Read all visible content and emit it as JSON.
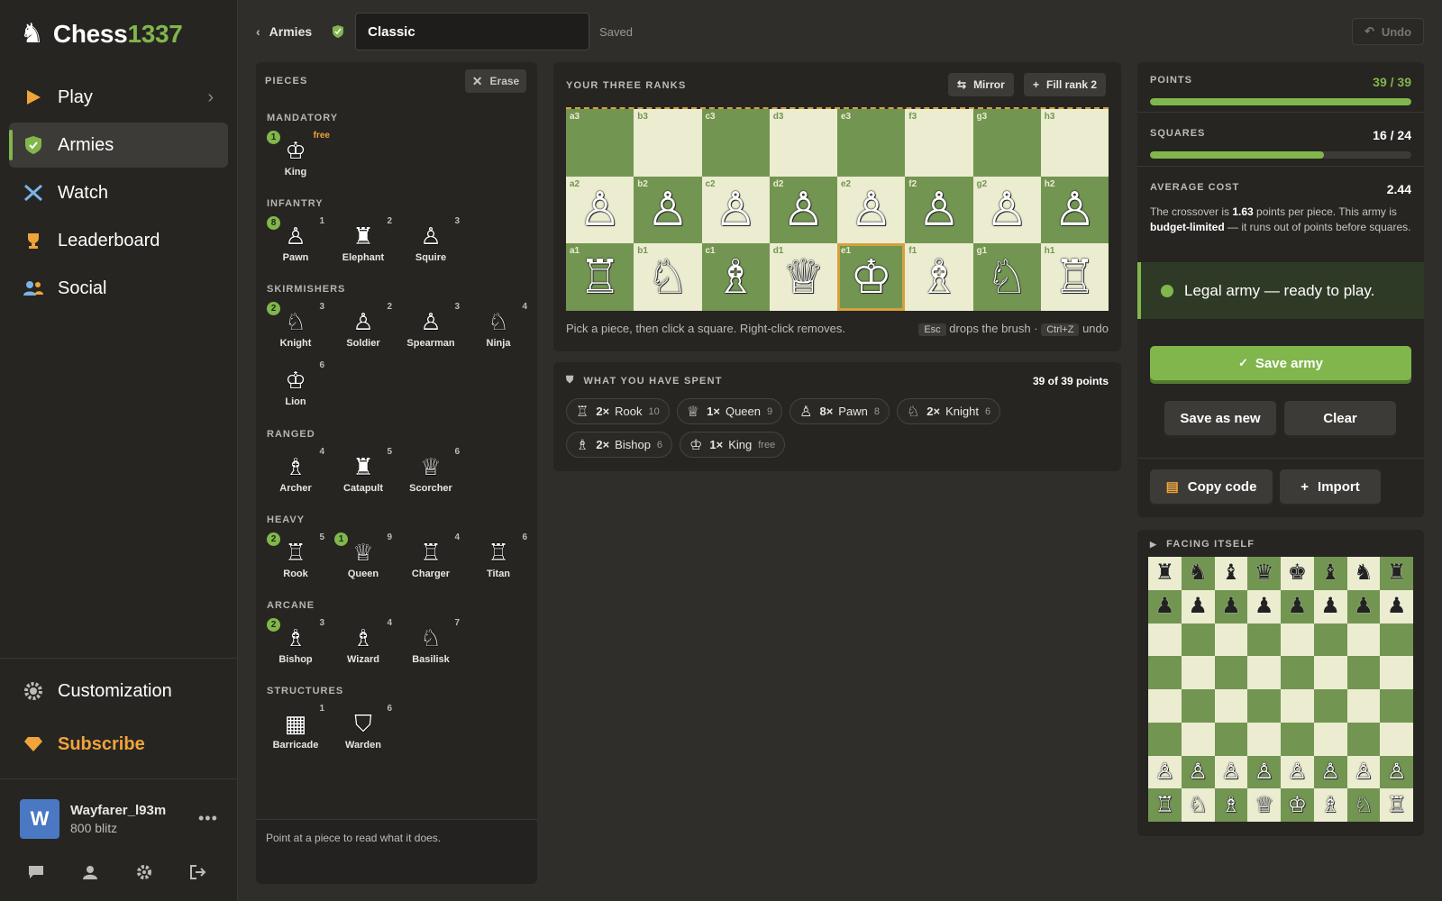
{
  "brand": {
    "name_a": "Chess",
    "name_b": "1337"
  },
  "nav": {
    "play": "Play",
    "armies": "Armies",
    "watch": "Watch",
    "leaderboard": "Leaderboard",
    "social": "Social",
    "customization": "Customization",
    "subscribe": "Subscribe"
  },
  "user": {
    "initial": "W",
    "name": "Wayfarer_l93m",
    "rating": "800 blitz"
  },
  "topbar": {
    "breadcrumb": "Armies",
    "army_name": "Classic",
    "status": "Saved",
    "undo": "Undo"
  },
  "pieces_panel": {
    "title": "PIECES",
    "erase": "Erase",
    "hint": "Point at a piece to read what it does.",
    "categories": {
      "mandatory": "MANDATORY",
      "infantry": "INFANTRY",
      "skirmishers": "SKIRMISHERS",
      "ranged": "RANGED",
      "heavy": "HEAVY",
      "arcane": "ARCANE",
      "structures": "STRUCTURES"
    },
    "pieces": {
      "king": {
        "label": "King",
        "cost": "free",
        "count": "1",
        "glyph": "♔"
      },
      "pawn": {
        "label": "Pawn",
        "cost": "1",
        "count": "8",
        "glyph": "♙"
      },
      "elephant": {
        "label": "Elephant",
        "cost": "2",
        "glyph": "♜"
      },
      "squire": {
        "label": "Squire",
        "cost": "3",
        "glyph": "♙"
      },
      "knight": {
        "label": "Knight",
        "cost": "3",
        "count": "2",
        "glyph": "♘"
      },
      "soldier": {
        "label": "Soldier",
        "cost": "2",
        "glyph": "♙"
      },
      "spearman": {
        "label": "Spearman",
        "cost": "3",
        "glyph": "♙"
      },
      "ninja": {
        "label": "Ninja",
        "cost": "4",
        "glyph": "♘"
      },
      "lion": {
        "label": "Lion",
        "cost": "6",
        "glyph": "♔"
      },
      "archer": {
        "label": "Archer",
        "cost": "4",
        "glyph": "♗"
      },
      "catapult": {
        "label": "Catapult",
        "cost": "5",
        "glyph": "♜"
      },
      "scorcher": {
        "label": "Scorcher",
        "cost": "6",
        "glyph": "♕"
      },
      "rook": {
        "label": "Rook",
        "cost": "5",
        "count": "2",
        "glyph": "♖"
      },
      "queen": {
        "label": "Queen",
        "cost": "9",
        "count": "1",
        "glyph": "♕"
      },
      "charger": {
        "label": "Charger",
        "cost": "4",
        "glyph": "♖"
      },
      "titan": {
        "label": "Titan",
        "cost": "6",
        "glyph": "♖"
      },
      "bishop": {
        "label": "Bishop",
        "cost": "3",
        "count": "2",
        "glyph": "♗"
      },
      "wizard": {
        "label": "Wizard",
        "cost": "4",
        "glyph": "♗"
      },
      "basilisk": {
        "label": "Basilisk",
        "cost": "7",
        "glyph": "♘"
      },
      "barricade": {
        "label": "Barricade",
        "cost": "1",
        "glyph": "▦"
      },
      "warden": {
        "label": "Warden",
        "cost": "6",
        "glyph": "⛉"
      }
    }
  },
  "ranks_panel": {
    "title": "YOUR THREE RANKS",
    "mirror": "Mirror",
    "fill": "Fill rank 2",
    "help": "Pick a piece, then click a square. Right-click removes.",
    "esc_key": "Esc",
    "esc_text": "drops the brush ·",
    "undo_key": "Ctrl+Z",
    "undo_text": "undo",
    "board": [
      [
        "a3",
        "",
        ""
      ],
      [
        "b3",
        "",
        ""
      ],
      [
        "c3",
        "",
        ""
      ],
      [
        "d3",
        "",
        ""
      ],
      [
        "e3",
        "",
        ""
      ],
      [
        "f3",
        "",
        ""
      ],
      [
        "g3",
        "",
        ""
      ],
      [
        "h3",
        "",
        ""
      ],
      [
        "a2",
        "♙",
        ""
      ],
      [
        "b2",
        "♙",
        ""
      ],
      [
        "c2",
        "♙",
        ""
      ],
      [
        "d2",
        "♙",
        ""
      ],
      [
        "e2",
        "♙",
        ""
      ],
      [
        "f2",
        "♙",
        ""
      ],
      [
        "g2",
        "♙",
        ""
      ],
      [
        "h2",
        "♙",
        ""
      ],
      [
        "a1",
        "♖",
        ""
      ],
      [
        "b1",
        "♘",
        ""
      ],
      [
        "c1",
        "♗",
        ""
      ],
      [
        "d1",
        "♕",
        ""
      ],
      [
        "e1",
        "♔",
        "sel"
      ],
      [
        "f1",
        "♗",
        ""
      ],
      [
        "g1",
        "♘",
        ""
      ],
      [
        "h1",
        "♖",
        ""
      ]
    ]
  },
  "spent_panel": {
    "title": "WHAT YOU HAVE SPENT",
    "total": "39 of 39 points",
    "chips": [
      {
        "glyph": "♖",
        "qty": "2×",
        "name": "Rook",
        "cost": "10"
      },
      {
        "glyph": "♕",
        "qty": "1×",
        "name": "Queen",
        "cost": "9"
      },
      {
        "glyph": "♙",
        "qty": "8×",
        "name": "Pawn",
        "cost": "8"
      },
      {
        "glyph": "♘",
        "qty": "2×",
        "name": "Knight",
        "cost": "6"
      },
      {
        "glyph": "♗",
        "qty": "2×",
        "name": "Bishop",
        "cost": "6"
      },
      {
        "glyph": "♔",
        "qty": "1×",
        "name": "King",
        "cost": "free"
      }
    ]
  },
  "stats": {
    "points_label": "POINTS",
    "points_value": "39 / 39",
    "points_fill": 1.0,
    "squares_label": "SQUARES",
    "squares_value": "16 / 24",
    "squares_fill": 0.667,
    "avg_label": "AVERAGE COST",
    "avg_value": "2.44",
    "avg_text_1": "The crossover is ",
    "avg_bold_1": "1.63",
    "avg_text_2": " points per piece. This army is ",
    "avg_bold_2": "budget-limited",
    "avg_text_3": " — it runs out of points before squares.",
    "legal": "Legal army — ready to play.",
    "save": "Save army",
    "save_new": "Save as new",
    "clear": "Clear",
    "copy": "Copy code",
    "import": "Import"
  },
  "facing": {
    "title": "FACING ITSELF",
    "black_back": "♜♞♝♛♚♝♞♜",
    "black_pawns": "♟♟♟♟♟♟♟♟",
    "white_pawns": "♙♙♙♙♙♙♙♙",
    "white_back": "♖♘♗♕♔♗♘♖"
  },
  "colors": {
    "accent": "#81b64c",
    "dark_square": "#739552",
    "light_square": "#ebecd0",
    "subscribe": "#f0a43b"
  }
}
